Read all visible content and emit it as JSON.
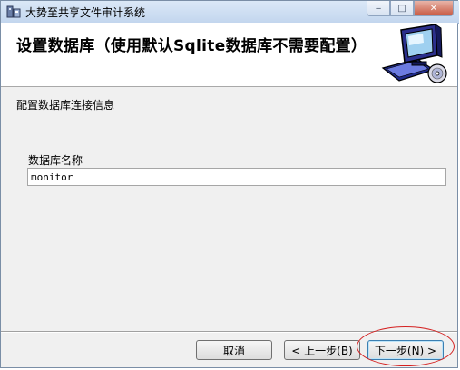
{
  "window": {
    "title": "大势至共享文件审计系统",
    "minimize_symbol": "‒",
    "maximize_symbol": "□",
    "close_symbol": "✕"
  },
  "header": {
    "title": "设置数据库（使用默认Sqlite数据库不需要配置）",
    "graphic_icon": "computer-with-disc-icon"
  },
  "content": {
    "section_label": "配置数据库连接信息",
    "field_label": "数据库名称",
    "field_value": "monitor"
  },
  "footer": {
    "cancel_label": "取消",
    "back_label": "< 上一步(B)",
    "next_label": "下一步(N) >"
  },
  "colors": {
    "accent": "#3c7fb1",
    "highlight_ring": "#d42020"
  }
}
